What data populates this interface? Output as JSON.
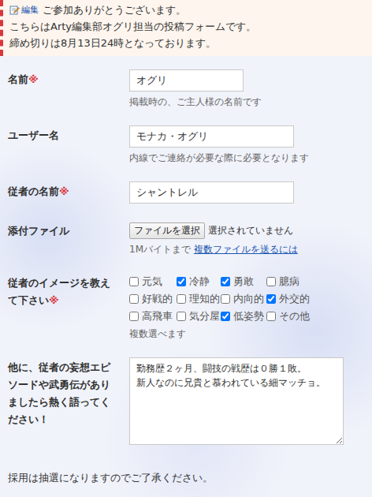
{
  "notice": {
    "edit_link": "編集",
    "lines": [
      "ご参加ありがとうございます。",
      "こちらはArty編集部オグリ担当の投稿フォームです。",
      "締め切りは8月13日24時となっております。"
    ]
  },
  "required_mark": "※",
  "form": {
    "fields": [
      {
        "kind": "text",
        "label": "名前",
        "required": true,
        "value": "オグリ",
        "hint": "掲載時の、ご主人様の名前です"
      },
      {
        "kind": "text",
        "label": "ユーザー名",
        "required": false,
        "value": "モナカ・オグリ",
        "hint": "内線でご連絡が必要な際に必要となります"
      },
      {
        "kind": "text",
        "label": "従者の名前",
        "required": true,
        "value": "シャントレル",
        "hint": ""
      },
      {
        "kind": "file",
        "label": "添付ファイル",
        "required": false,
        "button": "ファイルを選択",
        "status": "選択されていません",
        "hint": "1Mバイトまで",
        "link": "複数ファイルを送るには"
      },
      {
        "kind": "checkboxes",
        "label": "従者のイメージを教えて下さい",
        "required": true,
        "hint": "複数選べます",
        "options": [
          {
            "label": "元気",
            "checked": false
          },
          {
            "label": "冷静",
            "checked": true
          },
          {
            "label": "勇敢",
            "checked": true
          },
          {
            "label": "臆病",
            "checked": false
          },
          {
            "label": "好戦的",
            "checked": false
          },
          {
            "label": "理知的",
            "checked": false
          },
          {
            "label": "内向的",
            "checked": false
          },
          {
            "label": "外交的",
            "checked": true
          },
          {
            "label": "高飛車",
            "checked": false
          },
          {
            "label": "気分屋",
            "checked": false
          },
          {
            "label": "低姿勢",
            "checked": true
          },
          {
            "label": "その他",
            "checked": false
          }
        ]
      },
      {
        "kind": "textarea",
        "label": "他に、従者の妄想エピソードや武勇伝がありましたら熱く語ってください！",
        "required": false,
        "value": "勤務歴２ヶ月、闘技の戦歴は０勝１敗。\n新人なのに兄貴と慕われている細マッチョ。"
      }
    ]
  },
  "footer": "採用は抽選になりますのでご了承ください。"
}
